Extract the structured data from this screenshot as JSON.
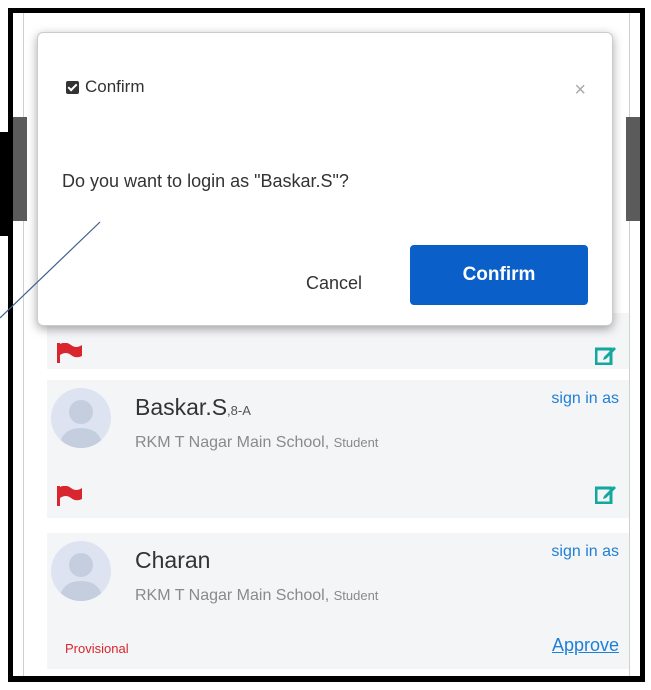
{
  "dialog": {
    "title": "Confirm",
    "close_glyph": "×",
    "message": "Do you want to login as \"Baskar.S\"?",
    "cancel_label": "Cancel",
    "confirm_label": "Confirm"
  },
  "users": [
    {
      "name": "Baskar.S",
      "section": ",8-A",
      "school": "RKM T Nagar Main School, ",
      "role": "Student",
      "sign_in_label": "sign in as"
    },
    {
      "name": "Charan",
      "school": "RKM T Nagar Main School, ",
      "role": "Student",
      "sign_in_label": "sign in as",
      "status": "Provisional",
      "approve_label": "Approve"
    }
  ],
  "colors": {
    "accent": "#0a5fc8",
    "link": "#1f7fd6",
    "flag": "#d9262e",
    "edit": "#13a89e",
    "card_bg": "#f4f5f7"
  },
  "icons": [
    "checkbox-icon",
    "close-icon",
    "avatar-icon",
    "flag-icon",
    "edit-icon"
  ]
}
